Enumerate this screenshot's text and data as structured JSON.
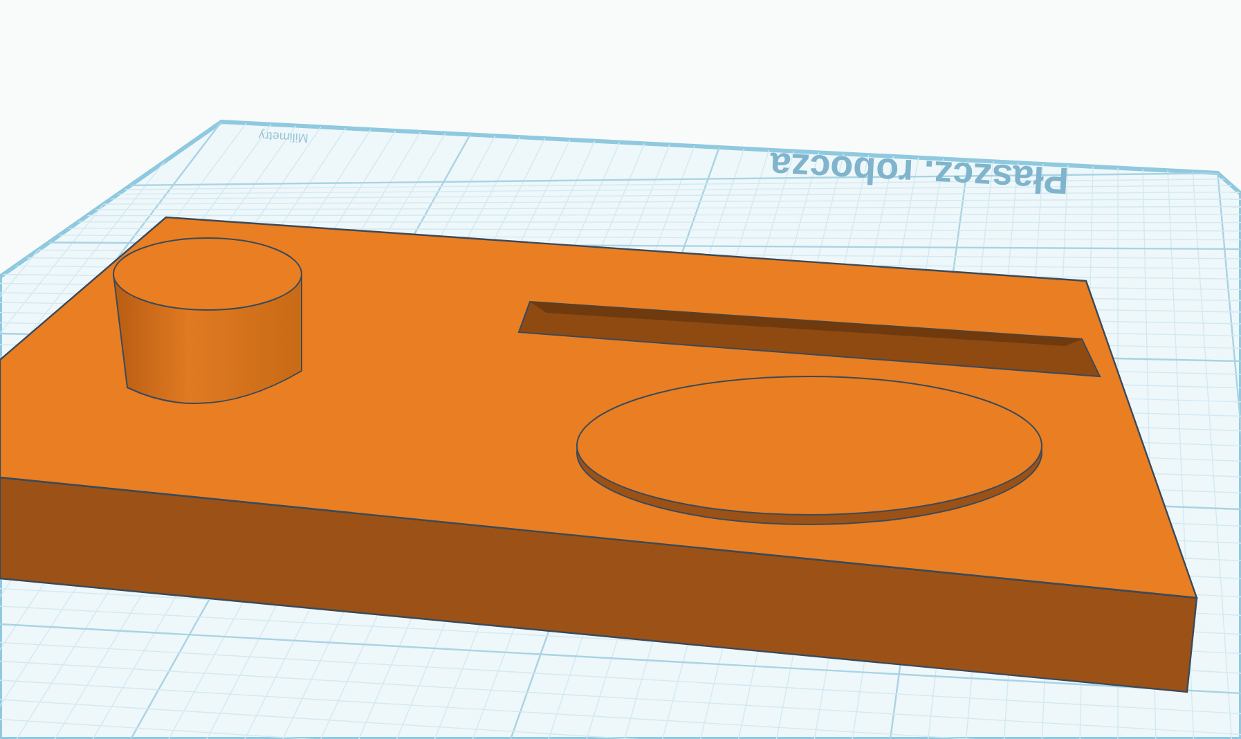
{
  "workplane": {
    "title": "Płaszcz. robocza",
    "units": "Milimetry"
  }
}
